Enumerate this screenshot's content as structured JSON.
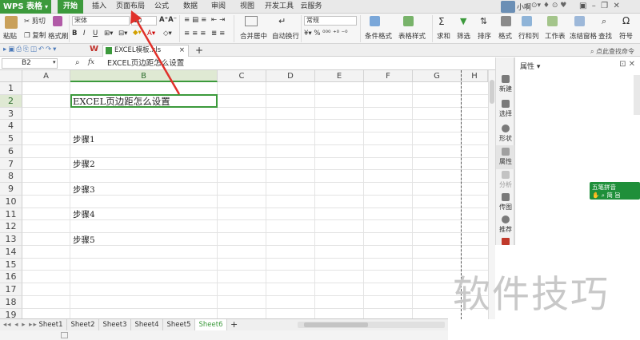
{
  "app": {
    "name": "WPS 表格"
  },
  "menu_tabs": [
    "开始",
    "插入",
    "页面布局",
    "公式",
    "数据",
    "审阅",
    "视图",
    "开发工具",
    "云服务"
  ],
  "user": {
    "name": "小啊"
  },
  "ribbon": {
    "paste": "粘贴",
    "cut": "剪切",
    "copy": "复制",
    "format_painter": "格式刷",
    "font_name": "宋体",
    "font_size": "10",
    "number_format": "常规",
    "merge_center": "合并居中",
    "wrap_text": "自动换行",
    "conditional_format": "条件格式",
    "table_style": "表格样式",
    "sum": "求和",
    "filter": "筛选",
    "sort": "排序",
    "format": "格式",
    "rows_cols": "行和列",
    "worksheet": "工作表",
    "freeze_panes": "冻结窗格",
    "find": "查找",
    "symbol": "符号"
  },
  "document": {
    "tab_name": "EXCEL模板.xls",
    "search_hint": "点此查找命令"
  },
  "formula_bar": {
    "cell_ref": "B2",
    "fx": "fx",
    "content": "EXCEL页边距怎么设置"
  },
  "columns": [
    "A",
    "B",
    "C",
    "D",
    "E",
    "F",
    "G",
    "H"
  ],
  "rows": [
    "1",
    "2",
    "3",
    "4",
    "5",
    "6",
    "7",
    "8",
    "9",
    "10",
    "11",
    "12",
    "13",
    "14",
    "15",
    "16",
    "17",
    "18",
    "19"
  ],
  "cells": {
    "b2": "EXCEL页边距怎么设置",
    "b5": "步骤1",
    "b7": "步骤2",
    "b9": "步骤3",
    "b11": "步骤4",
    "b13": "步骤5"
  },
  "side_panel": {
    "items": [
      "新建",
      "选择",
      "形状",
      "属性",
      "分析",
      "传图",
      "推荐"
    ],
    "title": "属性"
  },
  "ime": {
    "title": "五笔拼音",
    "row2": "简 旨"
  },
  "sheets": [
    "Sheet1",
    "Sheet2",
    "Sheet3",
    "Sheet4",
    "Sheet5",
    "Sheet6"
  ],
  "active_sheet": "Sheet6",
  "watermark": "软件技巧",
  "colors": {
    "accent": "#3c9a3c",
    "arrow": "#e0302a"
  }
}
